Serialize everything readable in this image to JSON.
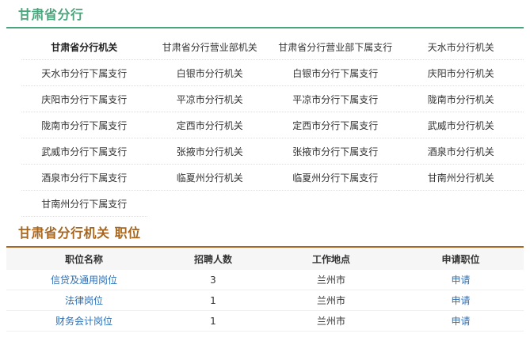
{
  "section_branches": {
    "title": "甘肃省分行",
    "items": [
      "甘肃省分行机关",
      "甘肃省分行营业部机关",
      "甘肃省分行营业部下属支行",
      "天水市分行机关",
      "天水市分行下属支行",
      "白银市分行机关",
      "白银市分行下属支行",
      "庆阳市分行机关",
      "庆阳市分行下属支行",
      "平凉市分行机关",
      "平凉市分行下属支行",
      "陇南市分行机关",
      "陇南市分行下属支行",
      "定西市分行机关",
      "定西市分行下属支行",
      "武威市分行机关",
      "武威市分行下属支行",
      "张掖市分行机关",
      "张掖市分行下属支行",
      "酒泉市分行机关",
      "酒泉市分行下属支行",
      "临夏州分行机关",
      "临夏州分行下属支行",
      "甘南州分行机关",
      "甘南州分行下属支行"
    ]
  },
  "section_jobs": {
    "title": "甘肃省分行机关 职位",
    "headers": [
      "职位名称",
      "招聘人数",
      "工作地点",
      "申请职位"
    ],
    "rows": [
      {
        "name": "信贷及通用岗位",
        "count": "3",
        "location": "兰州市",
        "apply": "申请"
      },
      {
        "name": "法律岗位",
        "count": "1",
        "location": "兰州市",
        "apply": "申请"
      },
      {
        "name": "财务会计岗位",
        "count": "1",
        "location": "兰州市",
        "apply": "申请"
      }
    ]
  },
  "colors": {
    "green": "#4aa57c",
    "brown": "#a7661f",
    "link": "#2b6fb6"
  }
}
